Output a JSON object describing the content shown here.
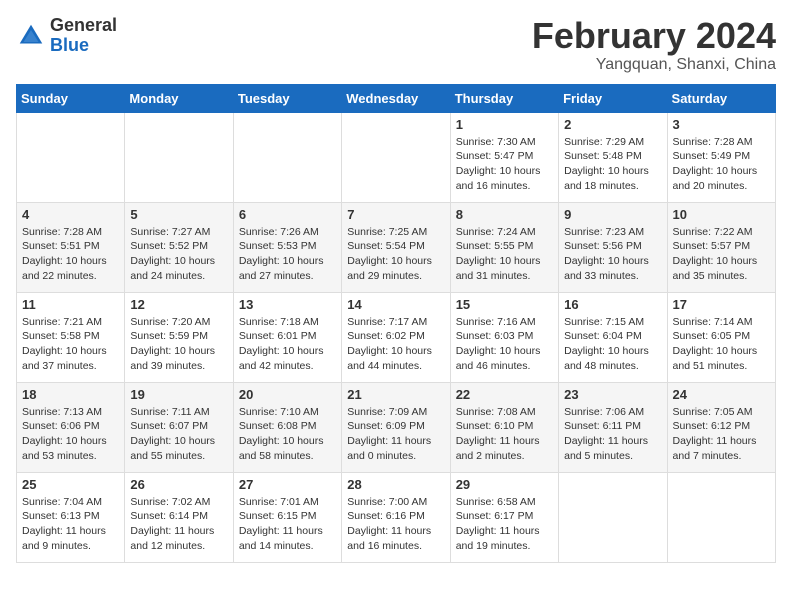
{
  "logo": {
    "general": "General",
    "blue": "Blue"
  },
  "title": "February 2024",
  "location": "Yangquan, Shanxi, China",
  "days_of_week": [
    "Sunday",
    "Monday",
    "Tuesday",
    "Wednesday",
    "Thursday",
    "Friday",
    "Saturday"
  ],
  "weeks": [
    [
      {
        "day": "",
        "info": ""
      },
      {
        "day": "",
        "info": ""
      },
      {
        "day": "",
        "info": ""
      },
      {
        "day": "",
        "info": ""
      },
      {
        "day": "1",
        "info": "Sunrise: 7:30 AM\nSunset: 5:47 PM\nDaylight: 10 hours\nand 16 minutes."
      },
      {
        "day": "2",
        "info": "Sunrise: 7:29 AM\nSunset: 5:48 PM\nDaylight: 10 hours\nand 18 minutes."
      },
      {
        "day": "3",
        "info": "Sunrise: 7:28 AM\nSunset: 5:49 PM\nDaylight: 10 hours\nand 20 minutes."
      }
    ],
    [
      {
        "day": "4",
        "info": "Sunrise: 7:28 AM\nSunset: 5:51 PM\nDaylight: 10 hours\nand 22 minutes."
      },
      {
        "day": "5",
        "info": "Sunrise: 7:27 AM\nSunset: 5:52 PM\nDaylight: 10 hours\nand 24 minutes."
      },
      {
        "day": "6",
        "info": "Sunrise: 7:26 AM\nSunset: 5:53 PM\nDaylight: 10 hours\nand 27 minutes."
      },
      {
        "day": "7",
        "info": "Sunrise: 7:25 AM\nSunset: 5:54 PM\nDaylight: 10 hours\nand 29 minutes."
      },
      {
        "day": "8",
        "info": "Sunrise: 7:24 AM\nSunset: 5:55 PM\nDaylight: 10 hours\nand 31 minutes."
      },
      {
        "day": "9",
        "info": "Sunrise: 7:23 AM\nSunset: 5:56 PM\nDaylight: 10 hours\nand 33 minutes."
      },
      {
        "day": "10",
        "info": "Sunrise: 7:22 AM\nSunset: 5:57 PM\nDaylight: 10 hours\nand 35 minutes."
      }
    ],
    [
      {
        "day": "11",
        "info": "Sunrise: 7:21 AM\nSunset: 5:58 PM\nDaylight: 10 hours\nand 37 minutes."
      },
      {
        "day": "12",
        "info": "Sunrise: 7:20 AM\nSunset: 5:59 PM\nDaylight: 10 hours\nand 39 minutes."
      },
      {
        "day": "13",
        "info": "Sunrise: 7:18 AM\nSunset: 6:01 PM\nDaylight: 10 hours\nand 42 minutes."
      },
      {
        "day": "14",
        "info": "Sunrise: 7:17 AM\nSunset: 6:02 PM\nDaylight: 10 hours\nand 44 minutes."
      },
      {
        "day": "15",
        "info": "Sunrise: 7:16 AM\nSunset: 6:03 PM\nDaylight: 10 hours\nand 46 minutes."
      },
      {
        "day": "16",
        "info": "Sunrise: 7:15 AM\nSunset: 6:04 PM\nDaylight: 10 hours\nand 48 minutes."
      },
      {
        "day": "17",
        "info": "Sunrise: 7:14 AM\nSunset: 6:05 PM\nDaylight: 10 hours\nand 51 minutes."
      }
    ],
    [
      {
        "day": "18",
        "info": "Sunrise: 7:13 AM\nSunset: 6:06 PM\nDaylight: 10 hours\nand 53 minutes."
      },
      {
        "day": "19",
        "info": "Sunrise: 7:11 AM\nSunset: 6:07 PM\nDaylight: 10 hours\nand 55 minutes."
      },
      {
        "day": "20",
        "info": "Sunrise: 7:10 AM\nSunset: 6:08 PM\nDaylight: 10 hours\nand 58 minutes."
      },
      {
        "day": "21",
        "info": "Sunrise: 7:09 AM\nSunset: 6:09 PM\nDaylight: 11 hours\nand 0 minutes."
      },
      {
        "day": "22",
        "info": "Sunrise: 7:08 AM\nSunset: 6:10 PM\nDaylight: 11 hours\nand 2 minutes."
      },
      {
        "day": "23",
        "info": "Sunrise: 7:06 AM\nSunset: 6:11 PM\nDaylight: 11 hours\nand 5 minutes."
      },
      {
        "day": "24",
        "info": "Sunrise: 7:05 AM\nSunset: 6:12 PM\nDaylight: 11 hours\nand 7 minutes."
      }
    ],
    [
      {
        "day": "25",
        "info": "Sunrise: 7:04 AM\nSunset: 6:13 PM\nDaylight: 11 hours\nand 9 minutes."
      },
      {
        "day": "26",
        "info": "Sunrise: 7:02 AM\nSunset: 6:14 PM\nDaylight: 11 hours\nand 12 minutes."
      },
      {
        "day": "27",
        "info": "Sunrise: 7:01 AM\nSunset: 6:15 PM\nDaylight: 11 hours\nand 14 minutes."
      },
      {
        "day": "28",
        "info": "Sunrise: 7:00 AM\nSunset: 6:16 PM\nDaylight: 11 hours\nand 16 minutes."
      },
      {
        "day": "29",
        "info": "Sunrise: 6:58 AM\nSunset: 6:17 PM\nDaylight: 11 hours\nand 19 minutes."
      },
      {
        "day": "",
        "info": ""
      },
      {
        "day": "",
        "info": ""
      }
    ]
  ]
}
